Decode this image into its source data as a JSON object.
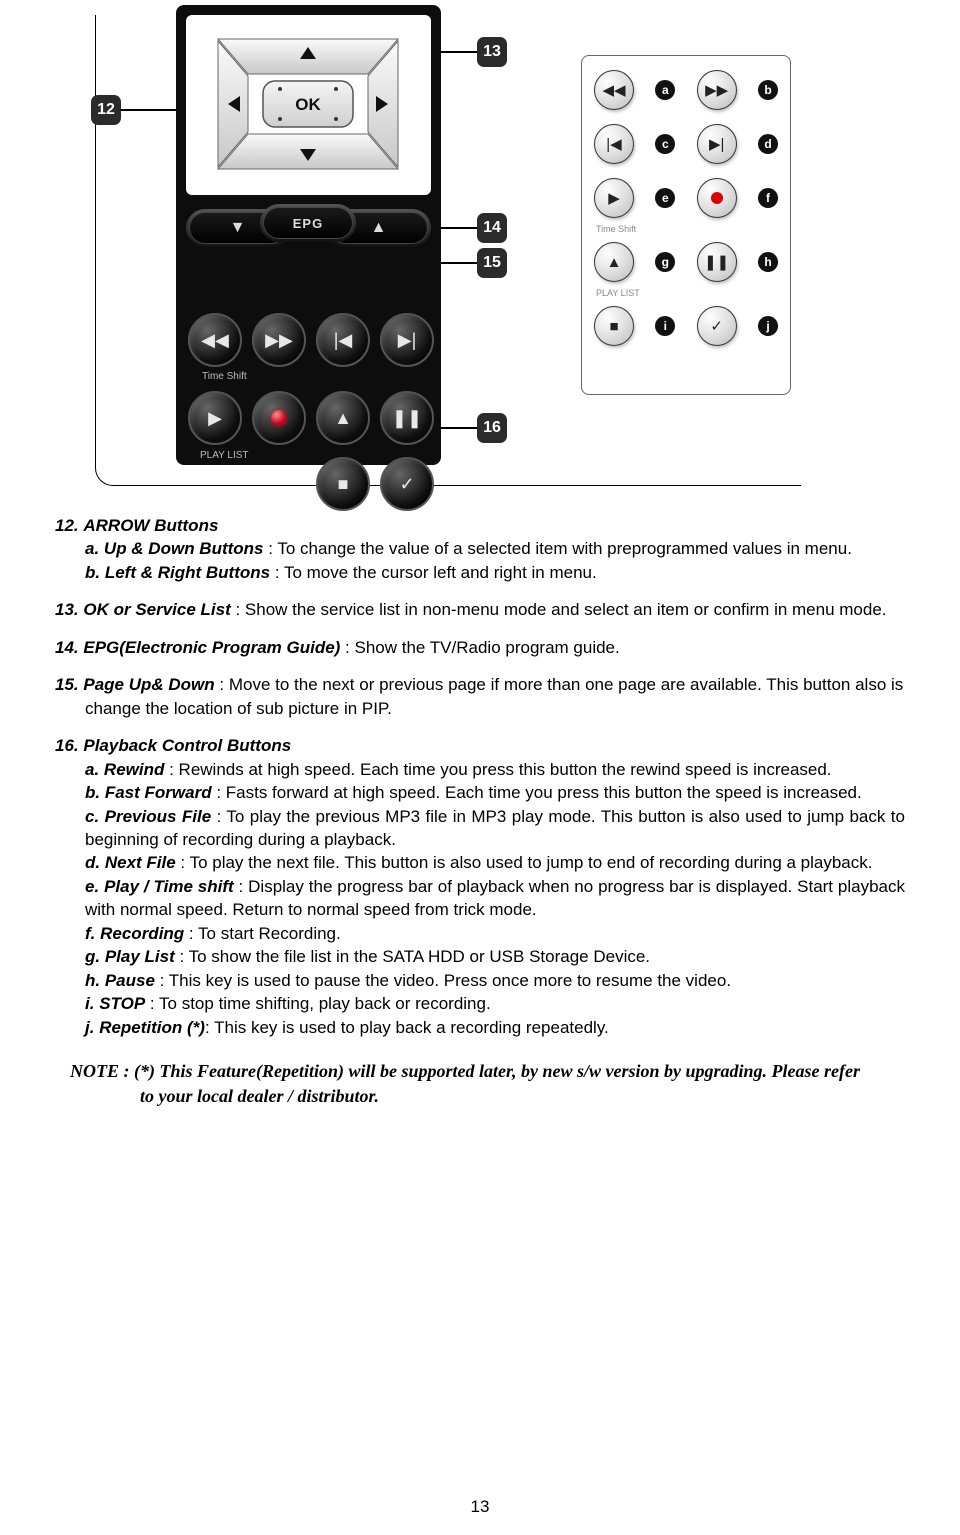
{
  "diagram": {
    "callouts": {
      "c12": "12",
      "c13": "13",
      "c14": "14",
      "c15": "15",
      "c16": "16"
    },
    "inset_labels": {
      "a": "a",
      "b": "b",
      "c": "c",
      "d": "d",
      "e": "e",
      "f": "f",
      "g": "g",
      "h": "h",
      "i": "i",
      "j": "j"
    },
    "remote": {
      "ok": "OK",
      "epg": "EPG",
      "timeshift": "Time Shift",
      "playlist": "PLAY LIST"
    },
    "inset_caption_ts": "Time Shift",
    "inset_caption_pl": "PLAY LIST"
  },
  "items": {
    "i12": {
      "num": "12.",
      "title": "ARROW Buttons",
      "a_label": "a.",
      "a_title": "Up & Down Buttons",
      "a_text": " : To change the value of a selected item with preprogrammed values in menu.",
      "b_label": "b.",
      "b_title": "Left & Right Buttons",
      "b_text": " : To move the cursor left and right in menu."
    },
    "i13": {
      "num": "13.",
      "title": "OK or Service List",
      "text": " : Show the service list in non-menu mode and select an item or confirm in menu mode."
    },
    "i14": {
      "num": "14.",
      "title": "EPG(Electronic Program Guide)",
      "text": " : Show the TV/Radio program guide."
    },
    "i15": {
      "num": "15.",
      "title": "Page Up& Down",
      "text": " : Move to the next or previous page if more than one page are available. This button also is change the location of sub picture in PIP."
    },
    "i16": {
      "num": "16.",
      "title": "Playback Control Buttons",
      "a": {
        "l": "a.",
        "t": "Rewind",
        "x": " : Rewinds at high speed. Each time you press this button the rewind speed is increased."
      },
      "b": {
        "l": "b.",
        "t": "Fast Forward",
        "x": " : Fasts forward at high speed. Each time you press this button the speed is increased."
      },
      "c": {
        "l": "c.",
        "t": "Previous File",
        "x": " : To play the previous MP3 file in MP3 play mode. This button is also used to jump back to beginning of recording during a playback."
      },
      "d": {
        "l": "d.",
        "t": "Next File",
        "x": " : To play the next file. This button is also used to jump to end of recording during a playback."
      },
      "e": {
        "l": "e.",
        "t": "Play / Time shift",
        "x": " : Display the progress bar of playback when no progress bar is displayed. Start playback with normal speed. Return to normal speed from trick mode."
      },
      "f": {
        "l": "f.",
        "t": "Recording",
        "x": " : To start Recording."
      },
      "g": {
        "l": "g.",
        "t": "Play List",
        "x": " : To show the file list in the SATA HDD or USB Storage Device."
      },
      "h": {
        "l": "h.",
        "t": "Pause",
        "x": " : This key is used to pause the video. Press once more to resume the video."
      },
      "i": {
        "l": "i.",
        "t": "STOP",
        "x": " : To stop time shifting, play back or recording."
      },
      "j": {
        "l": "j.",
        "t": "Repetition (*)",
        "x": ": This key is used to play back a recording repeatedly."
      }
    }
  },
  "note": "NOTE : (*) This Feature(Repetition) will be supported later, by new s/w version by upgrading. Please refer to your local dealer / distributor.",
  "page_number": "13"
}
